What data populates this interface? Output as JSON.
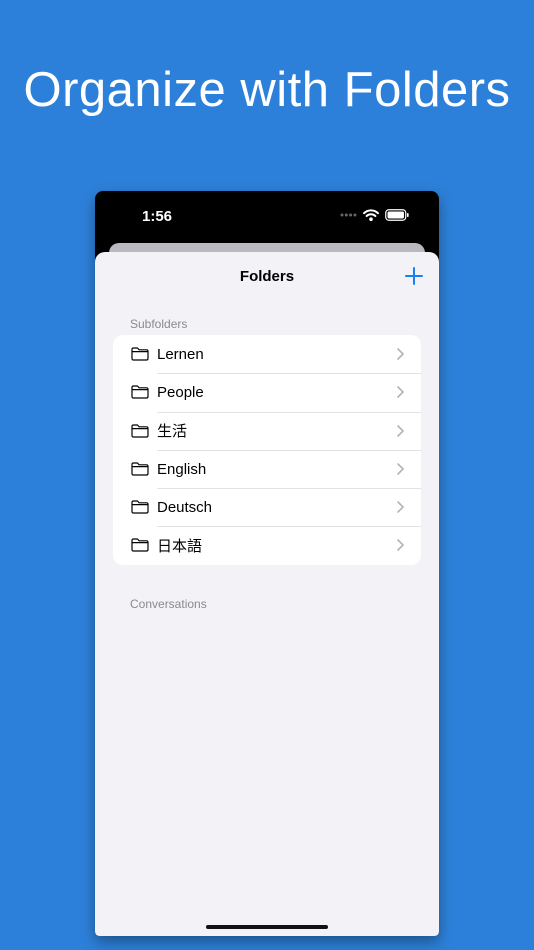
{
  "headline": "Organize with Folders",
  "status_bar": {
    "time": "1:56",
    "signal_icon": "signal-dots-icon",
    "wifi_icon": "wifi-icon",
    "battery_icon": "battery-icon"
  },
  "nav": {
    "title": "Folders",
    "add_icon": "plus-icon"
  },
  "subfolders": {
    "header": "Subfolders",
    "items": [
      {
        "label": "Lernen",
        "icon": "folder-icon"
      },
      {
        "label": "People",
        "icon": "folder-icon"
      },
      {
        "label": "生活",
        "icon": "folder-icon"
      },
      {
        "label": "English",
        "icon": "folder-icon"
      },
      {
        "label": "Deutsch",
        "icon": "folder-icon"
      },
      {
        "label": "日本語",
        "icon": "folder-icon"
      }
    ]
  },
  "conversations": {
    "header": "Conversations"
  },
  "colors": {
    "background": "#2d80d9",
    "accent": "#1a7ff0",
    "sheet": "#f2f2f7"
  }
}
